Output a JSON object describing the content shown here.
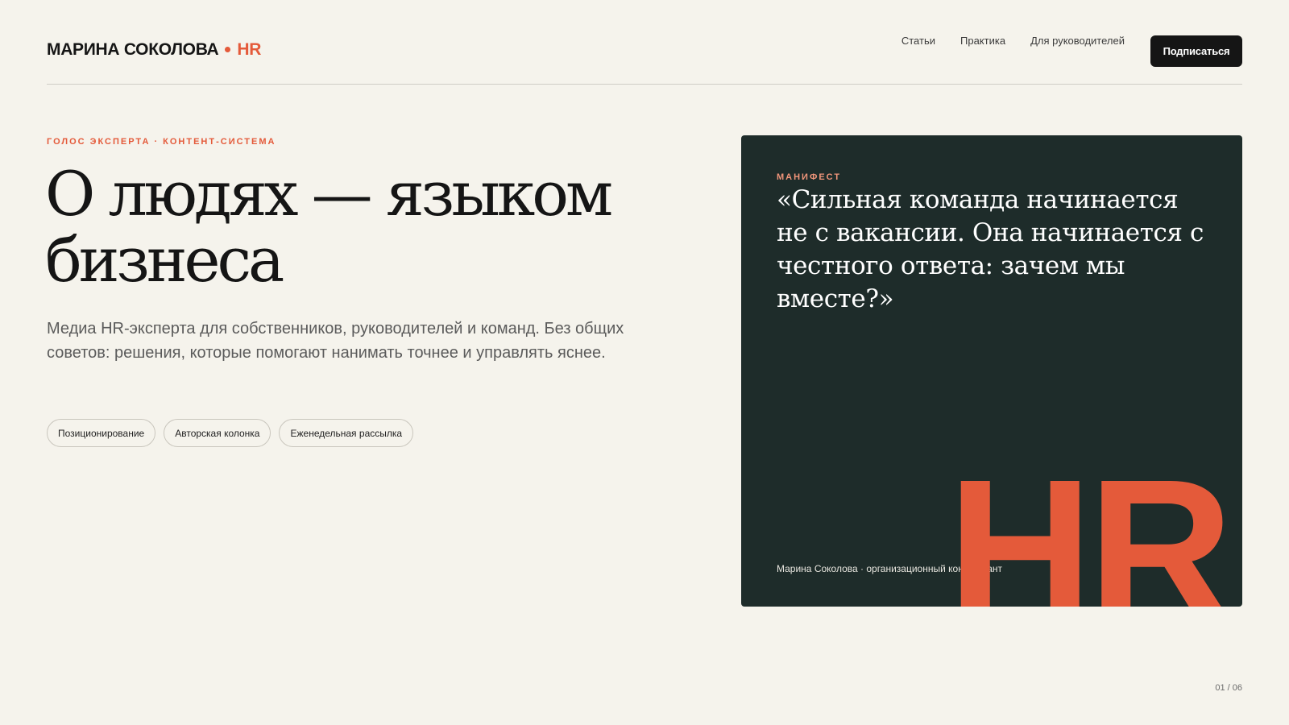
{
  "colors": {
    "background": "#f5f3ec",
    "accent": "#e45a3a",
    "card_background": "#1e2c2a",
    "text": "#151515"
  },
  "header": {
    "logo_name": "МАРИНА СОКОЛОВА",
    "logo_accent": "HR",
    "nav": [
      {
        "label": "Статьи"
      },
      {
        "label": "Практика"
      },
      {
        "label": "Для руководителей"
      }
    ],
    "subscribe_label": "Подписаться"
  },
  "hero": {
    "eyebrow": "ГОЛОС ЭКСПЕРТА · КОНТЕНТ-СИСТЕМА",
    "title": "О людях — языком бизнеса",
    "lead": "Медиа HR-эксперта для собственников, руководителей и команд. Без общих советов: решения, которые помогают нанимать точнее и управлять яснее.",
    "tags": [
      {
        "label": "Позиционирование"
      },
      {
        "label": "Авторская колонка"
      },
      {
        "label": "Еженедельная рассылка"
      }
    ]
  },
  "card": {
    "eyebrow": "МАНИФЕСТ",
    "quote": "«Сильная команда начинается не с вакансии. Она начинается с честного ответа: зачем мы вместе?»",
    "big_text": "HR",
    "signature": "Марина Соколова · организационный консультант"
  },
  "pager": "01 / 06"
}
